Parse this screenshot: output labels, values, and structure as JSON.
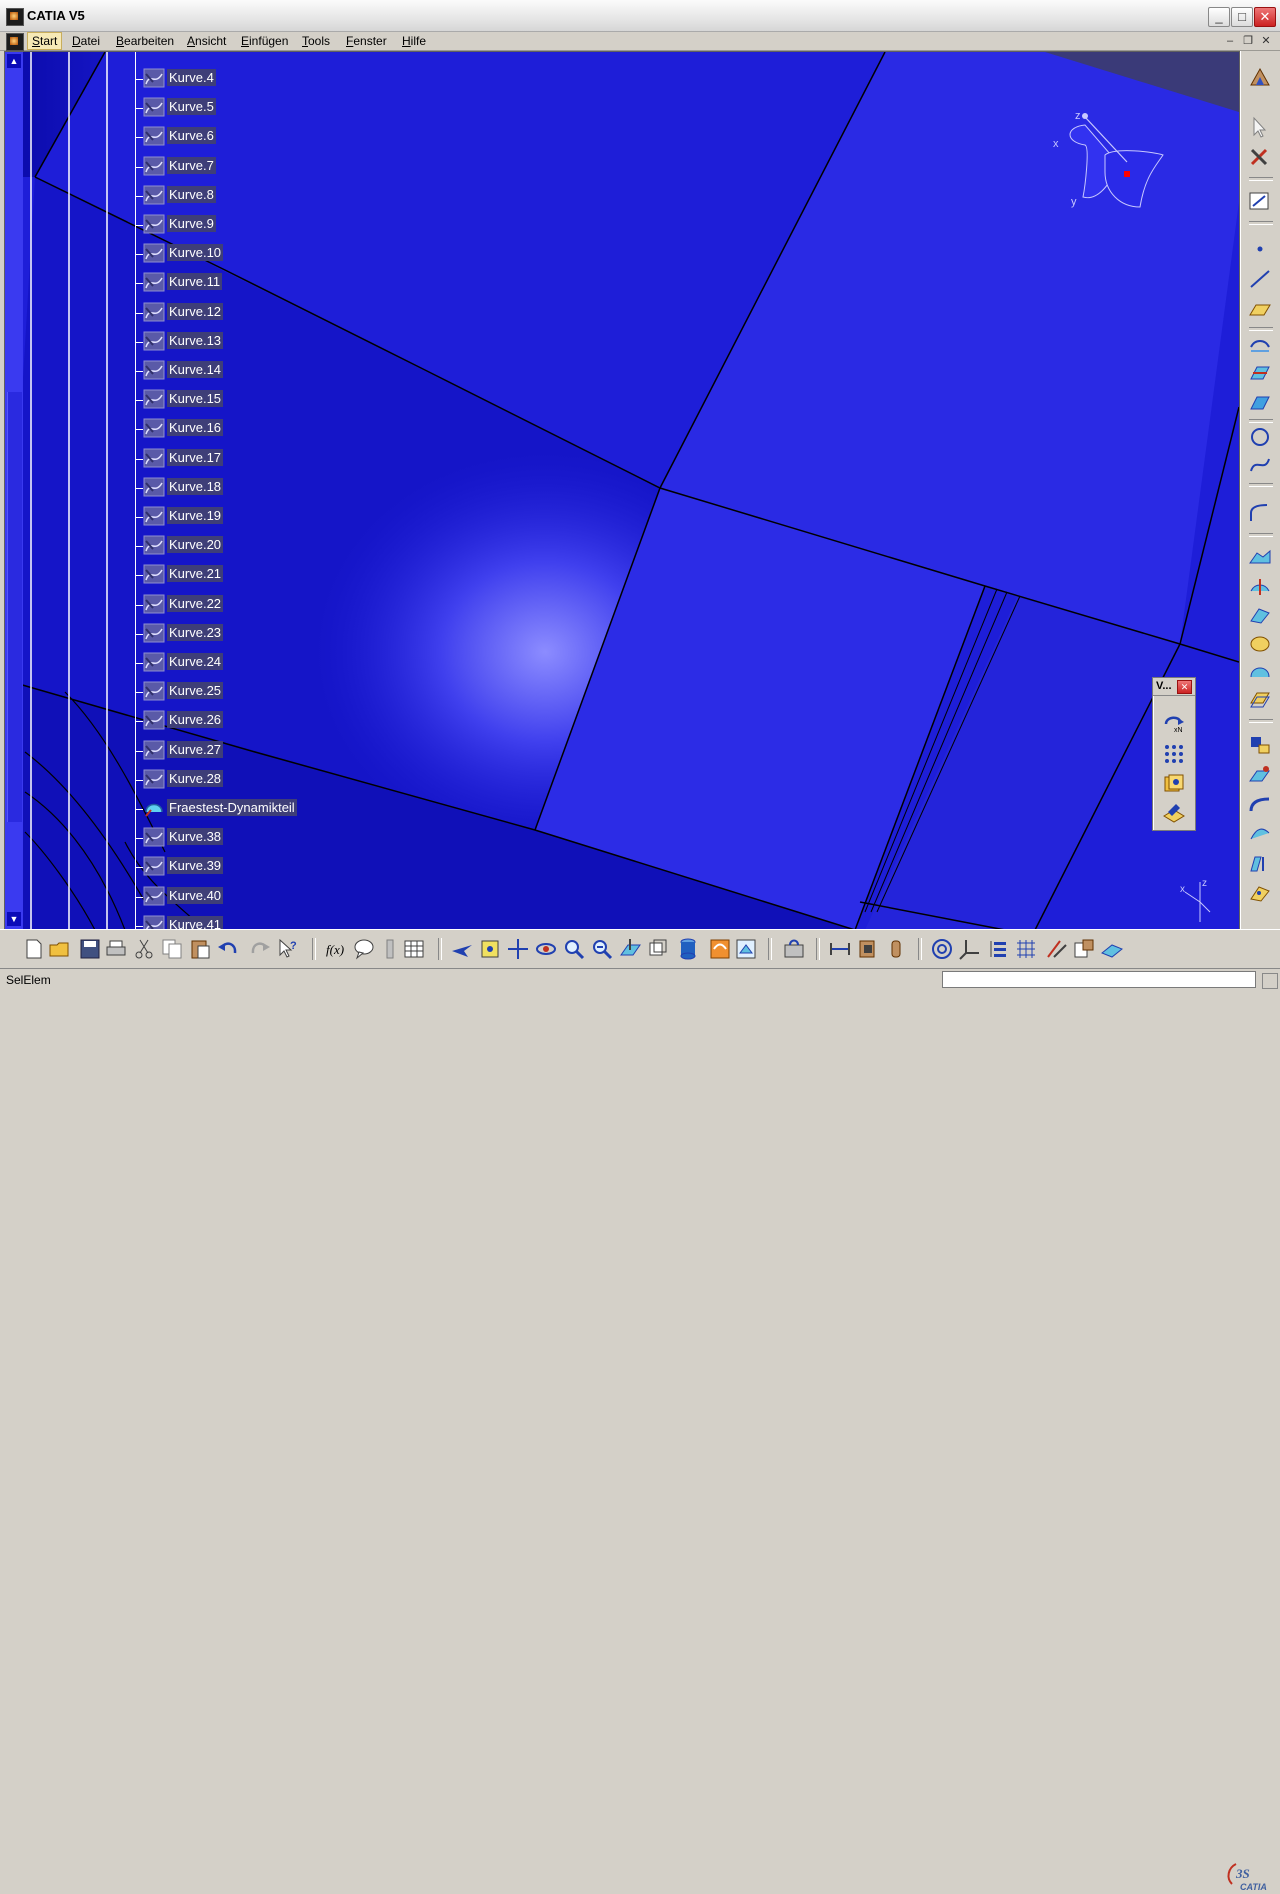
{
  "window": {
    "title": "CATIA V5"
  },
  "menu": {
    "items": [
      {
        "label": "Start",
        "underline": "S",
        "rest": "tart"
      },
      {
        "label": "Datei",
        "underline": "D",
        "rest": "atei"
      },
      {
        "label": "Bearbeiten",
        "underline": "B",
        "rest": "earbeiten"
      },
      {
        "label": "Ansicht",
        "underline": "A",
        "rest": "nsicht"
      },
      {
        "label": "Einfügen",
        "underline": "E",
        "rest": "infügen"
      },
      {
        "label": "Tools",
        "underline": "T",
        "rest": "ools"
      },
      {
        "label": "Fenster",
        "underline": "F",
        "rest": "enster"
      },
      {
        "label": "Hilfe",
        "underline": "H",
        "rest": "ilfe"
      }
    ]
  },
  "tree": {
    "items": [
      "Kurve.4",
      "Kurve.5",
      "Kurve.6",
      "Kurve.7",
      "Kurve.8",
      "Kurve.9",
      "Kurve.10",
      "Kurve.11",
      "Kurve.12",
      "Kurve.13",
      "Kurve.14",
      "Kurve.15",
      "Kurve.16",
      "Kurve.17",
      "Kurve.18",
      "Kurve.19",
      "Kurve.20",
      "Kurve.21",
      "Kurve.22",
      "Kurve.23",
      "Kurve.24",
      "Kurve.25",
      "Kurve.26",
      "Kurve.27",
      "Kurve.28",
      "Fraestest-Dynamikteil",
      "Kurve.38",
      "Kurve.39",
      "Kurve.40",
      "Kurve.41"
    ]
  },
  "compass": {
    "x_label": "x",
    "y_label": "y",
    "z_label": "z"
  },
  "mini_axis": {
    "x_label": "x",
    "z_label": "z"
  },
  "float_toolbar": {
    "title": "V..."
  },
  "status": {
    "text": "SelElem",
    "input_value": ""
  },
  "colors": {
    "viewport": "#1e1ed8",
    "tree_label_bg": "#3e3e78",
    "menu_active": "#f6e9b6"
  }
}
